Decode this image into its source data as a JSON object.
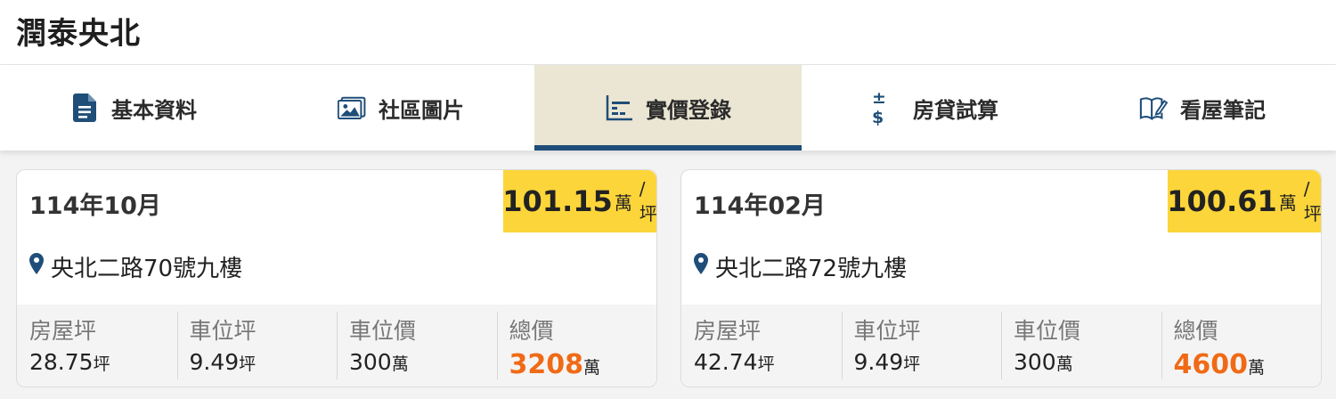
{
  "header": {
    "title": "潤泰央北"
  },
  "tabs": [
    {
      "label": "基本資料",
      "icon": "document-icon",
      "active": false
    },
    {
      "label": "社區圖片",
      "icon": "gallery-icon",
      "active": false
    },
    {
      "label": "實價登錄",
      "icon": "chart-icon",
      "active": true
    },
    {
      "label": "房貸試算",
      "icon": "plus-minus-dollar-icon",
      "icon_text": "±$",
      "active": false
    },
    {
      "label": "看屋筆記",
      "icon": "notebook-edit-icon",
      "active": false
    }
  ],
  "records": [
    {
      "date": "114年10月",
      "price_per_ping": "101.15",
      "price_unit": "萬",
      "price_suffix": "/坪",
      "address": "央北二路70號九樓",
      "house_area_label": "房屋坪",
      "house_area": "28.75",
      "house_area_unit": "坪",
      "parking_area_label": "車位坪",
      "parking_area": "9.49",
      "parking_area_unit": "坪",
      "parking_price_label": "車位價",
      "parking_price": "300",
      "parking_price_unit": "萬",
      "total_label": "總價",
      "total": "3208",
      "total_unit": "萬"
    },
    {
      "date": "114年02月",
      "price_per_ping": "100.61",
      "price_unit": "萬",
      "price_suffix": "/坪",
      "address": "央北二路72號九樓",
      "house_area_label": "房屋坪",
      "house_area": "42.74",
      "house_area_unit": "坪",
      "parking_area_label": "車位坪",
      "parking_area": "9.49",
      "parking_area_unit": "坪",
      "parking_price_label": "車位價",
      "parking_price": "300",
      "parking_price_unit": "萬",
      "total_label": "總價",
      "total": "4600",
      "total_unit": "萬"
    }
  ],
  "colors": {
    "accent_navy": "#1f4e79",
    "active_tab_bg": "#ebe6d3",
    "price_badge": "#fcd53a",
    "total_orange": "#f06a16"
  }
}
